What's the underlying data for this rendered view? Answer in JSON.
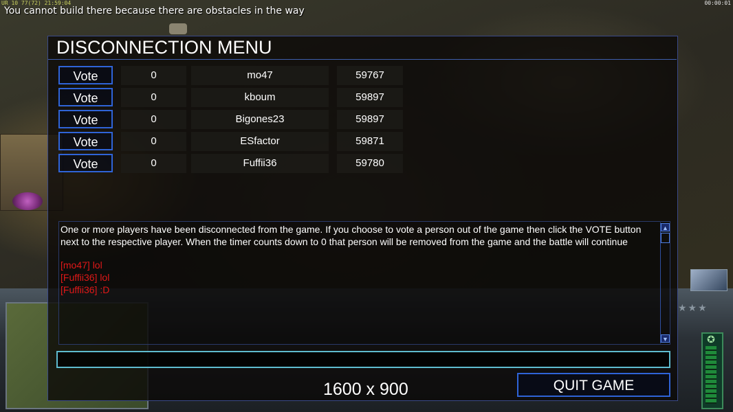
{
  "hud_top": {
    "info": "UR 10 77(72) 21:59:04",
    "clock": "00:00:01",
    "message": "You cannot build there because there are obstacles in the way"
  },
  "dialog": {
    "title": "DISCONNECTION MENU",
    "rows": [
      {
        "vote": "Vote",
        "count": "0",
        "name": "mo47",
        "ping": "59767"
      },
      {
        "vote": "Vote",
        "count": "0",
        "name": "kboum",
        "ping": "59897"
      },
      {
        "vote": "Vote",
        "count": "0",
        "name": "Bigones23",
        "ping": "59897"
      },
      {
        "vote": "Vote",
        "count": "0",
        "name": "ESfactor",
        "ping": "59871"
      },
      {
        "vote": "Vote",
        "count": "0",
        "name": "Fuffii36",
        "ping": "59780"
      }
    ],
    "info_text": "One or more players have been disconnected from the game. If you choose to vote a person out of the game then click the VOTE button next to the respective player. When the timer counts down to 0 that person will be removed from the game and the battle will continue",
    "chat": [
      "[mo47] lol",
      "[Fuffii36] lol",
      "[Fuffii36] :D"
    ],
    "chat_input_value": "",
    "resolution": "1600 x 900",
    "quit_label": "QUIT GAME"
  },
  "colors": {
    "button_border": "#2f64d8",
    "chat_text": "#e01818",
    "input_border": "#5fbcd0"
  }
}
